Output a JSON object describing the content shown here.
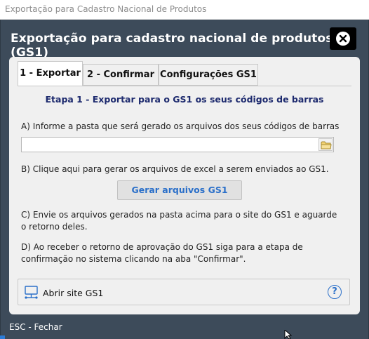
{
  "window": {
    "title": "Exportação para Cadastro Nacional de Produtos"
  },
  "dialog": {
    "title": "Exportação para cadastro nacional de produtos (GS1)",
    "close_icon": "close-icon",
    "background_color": "#3d4b5a"
  },
  "tabs": [
    {
      "label": "1 - Exportar",
      "active": true
    },
    {
      "label": "2 - Confirmar",
      "active": false
    },
    {
      "label": "Configurações GS1",
      "active": false
    }
  ],
  "step": {
    "title": "Etapa 1 - Exportar para o GS1 os seus códigos de barras",
    "title_color": "#1d2a6e"
  },
  "instructions": {
    "a": "A) Informe a pasta que será gerado os arquivos dos seus códigos de barras",
    "b": "B) Clique aqui para gerar os arquivos de excel a serem enviados ao GS1.",
    "c": "C) Envie os arquivos gerados na pasta acima para o site do GS1 e aguarde o retorno deles.",
    "d": "D) Ao receber o retorno de aprovação do GS1 siga para a etapa de confirmação no sistema clicando na aba \"Confirmar\"."
  },
  "folder_input": {
    "value": "",
    "placeholder": "",
    "icon": "folder-icon"
  },
  "generate_button": {
    "label": "Gerar arquivos GS1",
    "color": "#2a6fc9"
  },
  "footer": {
    "site_link_label": "Abrir site GS1",
    "site_icon": "monitor-network-icon",
    "help_icon": "help-icon",
    "help_symbol": "?"
  },
  "esc_hint": "ESC - Fechar"
}
